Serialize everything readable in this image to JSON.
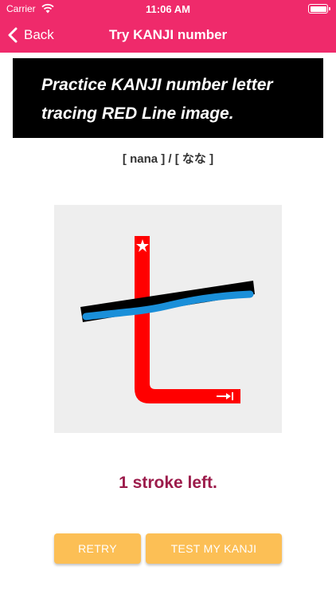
{
  "status_bar": {
    "carrier": "Carrier",
    "time": "11:06 AM"
  },
  "nav": {
    "back_label": "Back",
    "title": "Try KANJI number"
  },
  "banner": {
    "line1": "Practice KANJI number letter",
    "line2": "tracing RED Line image."
  },
  "reading": "[ nana ] / [ なな ]",
  "status_message": "1 stroke left.",
  "buttons": {
    "retry": "RETRY",
    "test": "TEST MY KANJI"
  },
  "colors": {
    "nav_bar": "#ef2a6b",
    "banner": "#000000",
    "guide_stroke": "#ff0000",
    "completed_stroke": "#000000",
    "user_trace": "#1a8fd9",
    "status_text": "#9c1c4b",
    "button": "#fcbf55"
  },
  "icons": {
    "stroke_start": "star-icon",
    "stroke_direction": "arrow-right-bar-icon"
  }
}
